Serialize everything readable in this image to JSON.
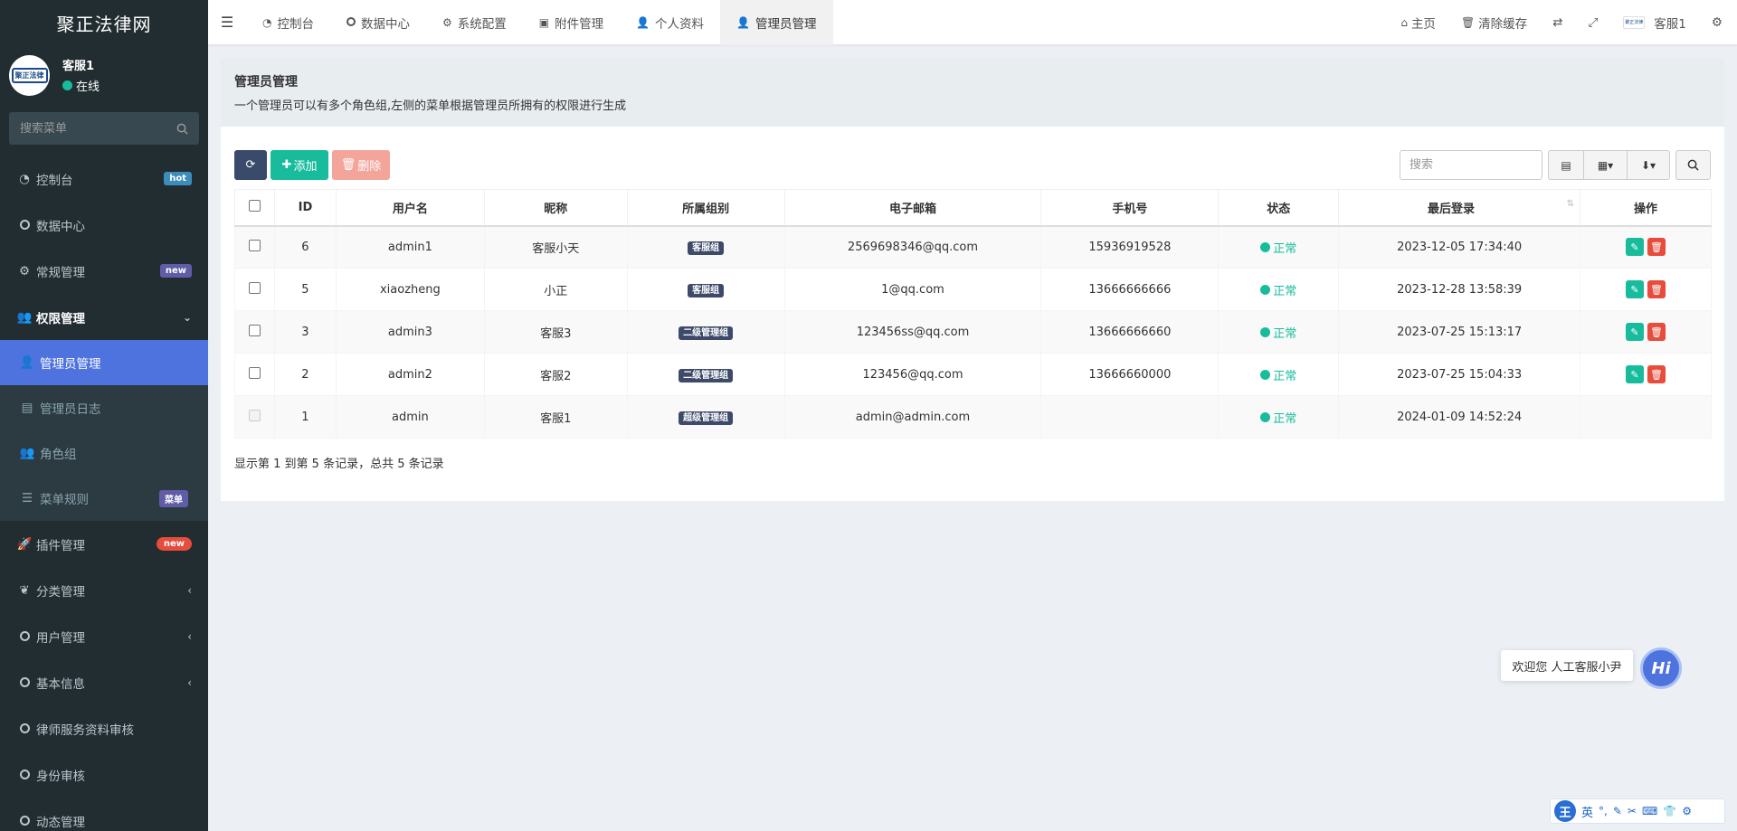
{
  "app": {
    "title": "聚正法律网",
    "logo_text": "聚正法律"
  },
  "user": {
    "name": "客服1",
    "status": "在线"
  },
  "sidebar": {
    "search_placeholder": "搜索菜单",
    "items": [
      {
        "label": "控制台",
        "icon": "dashboard-icon",
        "badge": "hot"
      },
      {
        "label": "数据中心",
        "icon": "circle-icon"
      },
      {
        "label": "常规管理",
        "icon": "cogs-icon",
        "badge": "new"
      },
      {
        "label": "权限管理",
        "icon": "group-icon"
      },
      {
        "label": "插件管理",
        "icon": "rocket-icon",
        "badge": "new"
      },
      {
        "label": "分类管理",
        "icon": "leaf-icon"
      },
      {
        "label": "用户管理",
        "icon": "circle-icon"
      },
      {
        "label": "基本信息",
        "icon": "circle-icon"
      },
      {
        "label": "律师服务资料审核",
        "icon": "circle-icon"
      },
      {
        "label": "身份审核",
        "icon": "circle-icon"
      },
      {
        "label": "动态管理",
        "icon": "circle-icon"
      }
    ],
    "sub_items": [
      {
        "label": "管理员管理",
        "icon": "user-icon"
      },
      {
        "label": "管理员日志",
        "icon": "list-alt-icon"
      },
      {
        "label": "角色组",
        "icon": "group-icon"
      },
      {
        "label": "菜单规则",
        "icon": "bars-icon",
        "badge": "菜单"
      }
    ]
  },
  "topbar": {
    "tabs": [
      {
        "label": "控制台",
        "icon": "dashboard-icon"
      },
      {
        "label": "数据中心",
        "icon": "circle-icon"
      },
      {
        "label": "系统配置",
        "icon": "cog-icon"
      },
      {
        "label": "附件管理",
        "icon": "image-icon"
      },
      {
        "label": "个人资料",
        "icon": "user-icon"
      },
      {
        "label": "管理员管理",
        "icon": "user-icon"
      }
    ],
    "right": {
      "home": "主页",
      "clear_cache": "清除缓存",
      "user": "客服1",
      "mini_logo": "聚正法律"
    }
  },
  "page": {
    "title": "管理员管理",
    "description": "一个管理员可以有多个角色组,左侧的菜单根据管理员所拥有的权限进行生成"
  },
  "toolbar": {
    "add_label": "添加",
    "delete_label": "删除",
    "search_placeholder": "搜索"
  },
  "table": {
    "columns": [
      "ID",
      "用户名",
      "昵称",
      "所属组别",
      "电子邮箱",
      "手机号",
      "状态",
      "最后登录",
      "操作"
    ],
    "rows": [
      {
        "id": "6",
        "username": "admin1",
        "nickname": "客服小天",
        "group": "客服组",
        "email": "2569698346@qq.com",
        "phone": "15936919528",
        "status": "正常",
        "last_login": "2023-12-05 17:34:40"
      },
      {
        "id": "5",
        "username": "xiaozheng",
        "nickname": "小正",
        "group": "客服组",
        "email": "1@qq.com",
        "phone": "13666666666",
        "status": "正常",
        "last_login": "2023-12-28 13:58:39"
      },
      {
        "id": "3",
        "username": "admin3",
        "nickname": "客服3",
        "group": "二级管理组",
        "email": "123456ss@qq.com",
        "phone": "13666666660",
        "status": "正常",
        "last_login": "2023-07-25 15:13:17"
      },
      {
        "id": "2",
        "username": "admin2",
        "nickname": "客服2",
        "group": "二级管理组",
        "email": "123456@qq.com",
        "phone": "13666660000",
        "status": "正常",
        "last_login": "2023-07-25 15:04:33"
      },
      {
        "id": "1",
        "username": "admin",
        "nickname": "客服1",
        "group": "超级管理组",
        "email": "admin@admin.com",
        "phone": "",
        "status": "正常",
        "last_login": "2024-01-09 14:52:24"
      }
    ],
    "summary": "显示第 1 到第 5 条记录，总共 5 条记录"
  },
  "chat": {
    "tip": "欢迎您 人工客服小尹",
    "button": "Hi"
  },
  "ime": {
    "logo": "王",
    "lang": "英"
  },
  "colors": {
    "sidebar_bg": "#222d32",
    "active": "#4e73df",
    "success": "#18bc9c",
    "danger": "#e74c3c"
  }
}
